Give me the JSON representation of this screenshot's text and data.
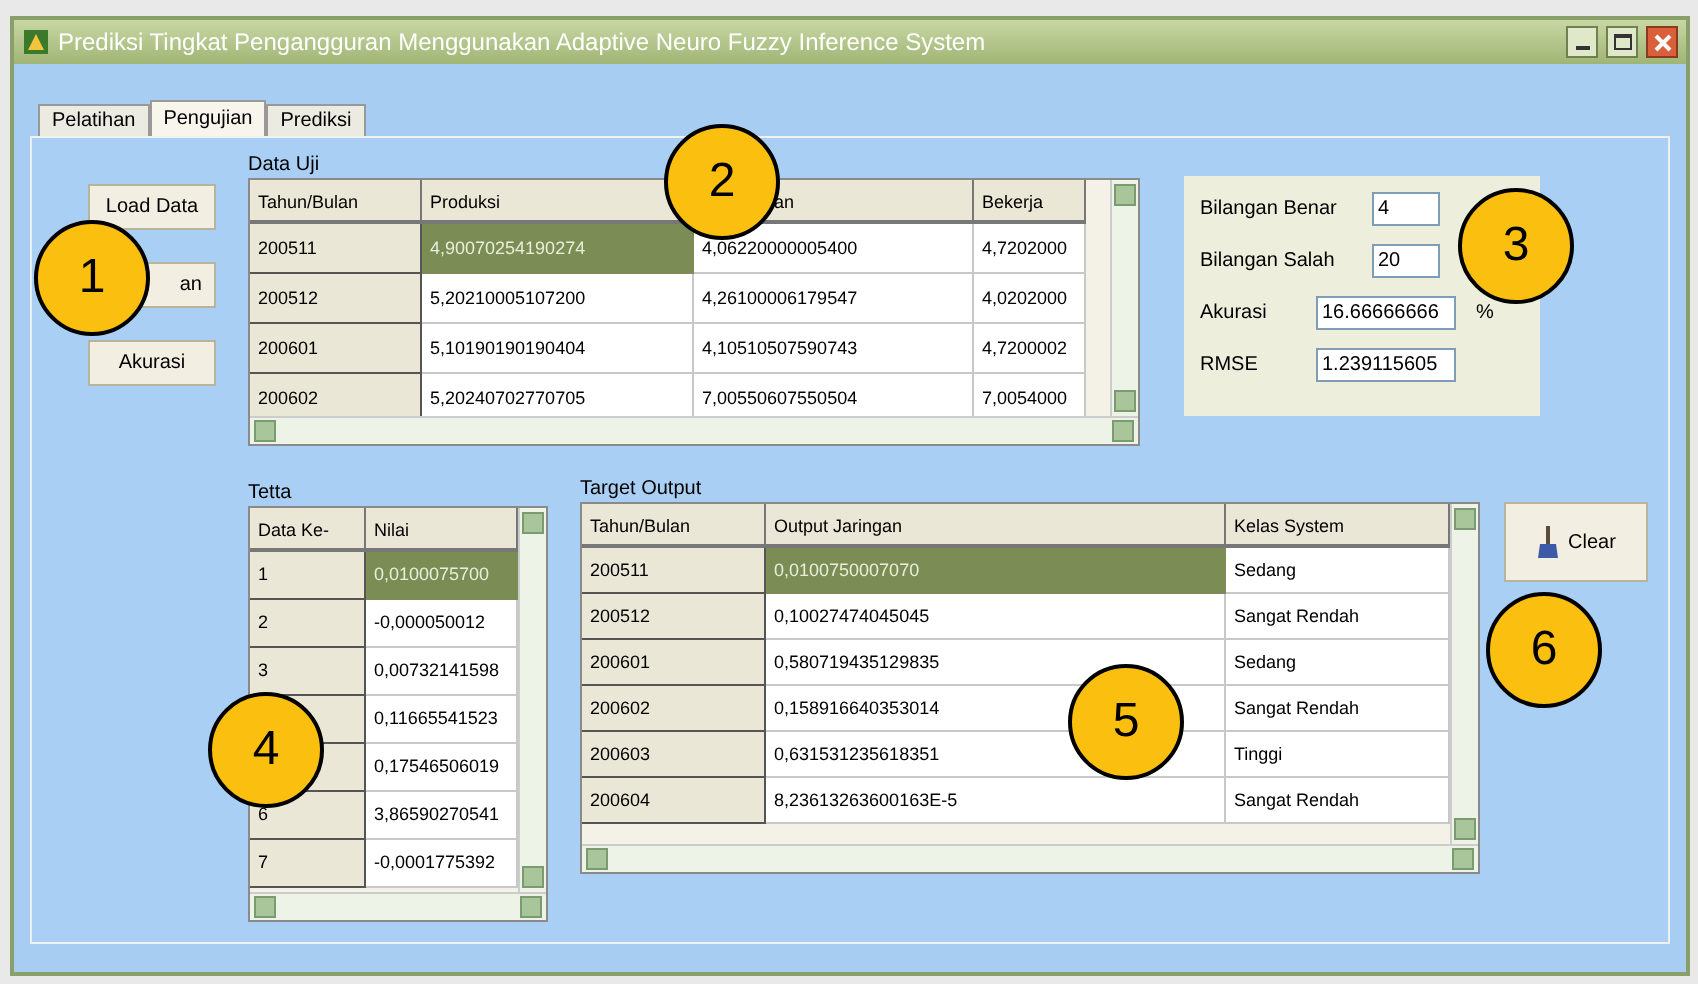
{
  "window": {
    "title": "Prediksi Tingkat Pengangguran Menggunakan Adaptive Neuro Fuzzy Inference System"
  },
  "tabs": [
    {
      "label": "Pelatihan",
      "selected": false
    },
    {
      "label": "Pengujian",
      "selected": true
    },
    {
      "label": "Prediksi",
      "selected": false
    }
  ],
  "buttons": [
    "Load Data",
    "an",
    "Akurasi"
  ],
  "data_uji": {
    "title": "Data Uji",
    "columns": [
      "Tahun/Bulan",
      "Produksi",
      "an",
      "Bekerja"
    ],
    "rows": [
      {
        "cells": [
          "200511",
          "4,90070254190274",
          "4,06220000005400",
          "4,7202000"
        ],
        "selected": true
      },
      {
        "cells": [
          "200512",
          "5,20210005107200",
          "4,26100006179547",
          "4,0202000"
        ],
        "selected": false
      },
      {
        "cells": [
          "200601",
          "5,10190190190404",
          "4,10510507590743",
          "4,7200002"
        ],
        "selected": false
      },
      {
        "cells": [
          "200602",
          "5,20240702770705",
          "7,00550607550504",
          "7,0054000"
        ],
        "selected": false
      }
    ]
  },
  "result": {
    "fields": [
      {
        "label": "Bilangan Benar",
        "value": "4"
      },
      {
        "label": "Bilangan Salah",
        "value": "20"
      },
      {
        "label": "Akurasi",
        "value": "16.66666666",
        "unit": "%"
      },
      {
        "label": "RMSE",
        "value": "1.239115605"
      }
    ]
  },
  "tetta": {
    "title": "Tetta",
    "columns": [
      "Data Ke-",
      "Nilai"
    ],
    "rows": [
      {
        "cells": [
          "1",
          "0,0100075700"
        ],
        "selected": true
      },
      {
        "cells": [
          "2",
          "-0,000050012"
        ],
        "selected": false
      },
      {
        "cells": [
          "3",
          "0,00732141598"
        ],
        "selected": false
      },
      {
        "cells": [
          "",
          "0,11665541523"
        ],
        "selected": false
      },
      {
        "cells": [
          "",
          "0,17546506019"
        ],
        "selected": false
      },
      {
        "cells": [
          "6",
          "3,86590270541"
        ],
        "selected": false
      },
      {
        "cells": [
          "7",
          "-0,0001775392"
        ],
        "selected": false
      }
    ]
  },
  "target_output": {
    "title": "Target Output",
    "columns": [
      "Tahun/Bulan",
      "Output Jaringan",
      "Kelas System"
    ],
    "rows": [
      {
        "cells": [
          "200511",
          "0,0100750007070",
          "Sedang"
        ],
        "selected": true
      },
      {
        "cells": [
          "200512",
          "0,10027474045045",
          "Sangat Rendah"
        ],
        "selected": false
      },
      {
        "cells": [
          "200601",
          "0,580719435129835",
          "Sedang"
        ],
        "selected": false
      },
      {
        "cells": [
          "200602",
          "0,158916640353014",
          "Sangat Rendah"
        ],
        "selected": false
      },
      {
        "cells": [
          "200603",
          "0,631531235618351",
          "Tinggi"
        ],
        "selected": false
      },
      {
        "cells": [
          "200604",
          "8,23613263600163E-5",
          "Sangat Rendah"
        ],
        "selected": false
      }
    ]
  },
  "clear_button": "Clear",
  "callouts": [
    "1",
    "2",
    "3",
    "4",
    "5",
    "6"
  ]
}
